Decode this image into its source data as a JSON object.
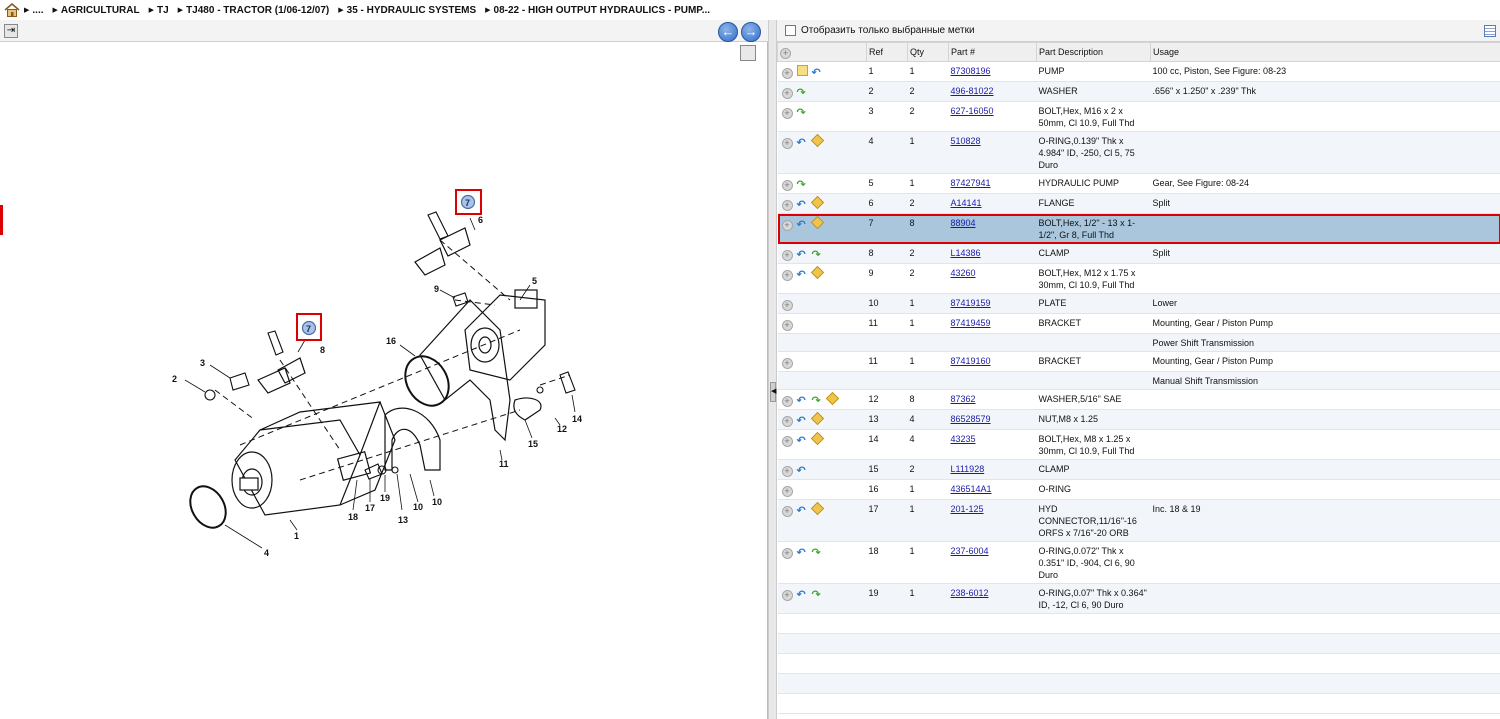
{
  "breadcrumb": [
    "....",
    "AGRICULTURAL",
    "TJ",
    "TJ480 - TRACTOR (1/06-12/07)",
    "35 - HYDRAULIC SYSTEMS",
    "08-22 - HIGH OUTPUT HYDRAULICS - PUMP..."
  ],
  "filter": {
    "label": "Отобразить только выбранные метки"
  },
  "nav": {
    "back": "←",
    "forward": "→"
  },
  "columns": {
    "ref": "Ref",
    "qty": "Qty",
    "part": "Part #",
    "desc": "Part Description",
    "usage": "Usage"
  },
  "rows": [
    {
      "icons": [
        "plus",
        "note",
        "blue"
      ],
      "ref": "1",
      "qty": "1",
      "part": "87308196",
      "desc": "PUMP",
      "usage": "100 cc, Piston, See Figure: 08-23"
    },
    {
      "icons": [
        "plus",
        "green"
      ],
      "ref": "2",
      "qty": "2",
      "part": "496-81022",
      "desc": "WASHER",
      "usage": ".656\" x 1.250\" x .239\" Thk"
    },
    {
      "icons": [
        "plus",
        "green"
      ],
      "ref": "3",
      "qty": "2",
      "part": "627-16050",
      "desc": "BOLT,Hex, M16 x 2 x 50mm, Cl 10.9, Full Thd",
      "usage": ""
    },
    {
      "icons": [
        "plus",
        "blue",
        "box"
      ],
      "ref": "4",
      "qty": "1",
      "part": "510828",
      "desc": "O-RING,0.139\" Thk x 4.984\" ID, -250, Cl 5, 75 Duro",
      "usage": ""
    },
    {
      "icons": [
        "plus",
        "green"
      ],
      "ref": "5",
      "qty": "1",
      "part": "87427941",
      "desc": "HYDRAULIC PUMP",
      "usage": "Gear, See Figure: 08-24"
    },
    {
      "icons": [
        "plus",
        "blue",
        "box"
      ],
      "ref": "6",
      "qty": "2",
      "part": "A14141",
      "desc": "FLANGE",
      "usage": "Split"
    },
    {
      "icons": [
        "plus",
        "blue",
        "box"
      ],
      "ref": "7",
      "qty": "8",
      "part": "88904",
      "desc": "BOLT,Hex, 1/2\" - 13 x 1-1/2\", Gr 8, Full Thd",
      "usage": "",
      "selected": true
    },
    {
      "icons": [
        "plus",
        "blue",
        "green"
      ],
      "ref": "8",
      "qty": "2",
      "part": "L14386",
      "desc": "CLAMP",
      "usage": "Split"
    },
    {
      "icons": [
        "plus",
        "blue",
        "box"
      ],
      "ref": "9",
      "qty": "2",
      "part": "43260",
      "desc": "BOLT,Hex, M12 x 1.75 x 30mm, Cl 10.9, Full Thd",
      "usage": ""
    },
    {
      "icons": [
        "plus"
      ],
      "ref": "10",
      "qty": "1",
      "part": "87419159",
      "desc": "PLATE",
      "usage": "Lower"
    },
    {
      "icons": [
        "plus"
      ],
      "ref": "11",
      "qty": "1",
      "part": "87419459",
      "desc": "BRACKET",
      "usage": "Mounting, Gear / Piston Pump"
    },
    {
      "icons": [],
      "ref": "",
      "qty": "",
      "part": "",
      "desc": "",
      "usage": "Power Shift  Transmission"
    },
    {
      "icons": [
        "plus"
      ],
      "ref": "11",
      "qty": "1",
      "part": "87419160",
      "desc": "BRACKET",
      "usage": "Mounting, Gear / Piston Pump"
    },
    {
      "icons": [],
      "ref": "",
      "qty": "",
      "part": "",
      "desc": "",
      "usage": "Manual Shift Transmission"
    },
    {
      "icons": [
        "plus",
        "blue",
        "green",
        "box"
      ],
      "ref": "12",
      "qty": "8",
      "part": "87362",
      "desc": "WASHER,5/16\" SAE",
      "usage": ""
    },
    {
      "icons": [
        "plus",
        "blue",
        "box"
      ],
      "ref": "13",
      "qty": "4",
      "part": "86528579",
      "desc": "NUT,M8 x 1.25",
      "usage": ""
    },
    {
      "icons": [
        "plus",
        "blue",
        "box"
      ],
      "ref": "14",
      "qty": "4",
      "part": "43235",
      "desc": "BOLT,Hex, M8 x 1.25 x 30mm, Cl 10.9, Full Thd",
      "usage": ""
    },
    {
      "icons": [
        "plus",
        "blue"
      ],
      "ref": "15",
      "qty": "2",
      "part": "L111928",
      "desc": "CLAMP",
      "usage": ""
    },
    {
      "icons": [
        "plus"
      ],
      "ref": "16",
      "qty": "1",
      "part": "436514A1",
      "desc": "O-RING",
      "usage": ""
    },
    {
      "icons": [
        "plus",
        "blue",
        "box"
      ],
      "ref": "17",
      "qty": "1",
      "part": "201-125",
      "desc": "HYD CONNECTOR,11/16\"-16 ORFS x 7/16\"-20 ORB",
      "usage": "Inc. 18 & 19"
    },
    {
      "icons": [
        "plus",
        "blue",
        "green"
      ],
      "ref": "18",
      "qty": "1",
      "part": "237-6004",
      "desc": "O-RING,0.072\" Thk x 0.351\" ID, -904, Cl 6, 90 Duro",
      "usage": ""
    },
    {
      "icons": [
        "plus",
        "blue",
        "green"
      ],
      "ref": "19",
      "qty": "1",
      "part": "238-6012",
      "desc": "O-RING,0.07\" Thk x 0.364\" ID, -12, Cl 6, 90 Duro",
      "usage": ""
    }
  ],
  "diagram": {
    "labels": [
      "1",
      "2",
      "3",
      "4",
      "5",
      "6",
      "7",
      "8",
      "9",
      "10",
      "11",
      "12",
      "13",
      "14",
      "15",
      "16",
      "17",
      "18",
      "19"
    ],
    "callout_label": "7"
  }
}
